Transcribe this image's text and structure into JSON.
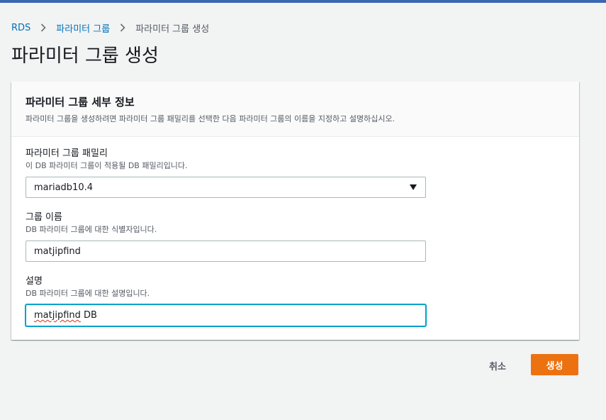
{
  "breadcrumb": {
    "items": [
      "RDS",
      "파라미터 그룹",
      "파라미터 그룹 생성"
    ]
  },
  "page": {
    "title": "파라미터 그룹 생성"
  },
  "panel": {
    "title": "파라미터 그룹 세부 정보",
    "description": "파라미터 그룹을 생성하려면 파라미터 그룹 패밀리를 선택한 다음 파라미터 그룹의 이름을 지정하고 설명하십시오."
  },
  "fields": {
    "family": {
      "label": "파라미터 그룹 패밀리",
      "description": "이 DB 파라미터 그룹이 적용될 DB 패밀리입니다.",
      "value": "mariadb10.4"
    },
    "name": {
      "label": "그룹 이름",
      "description": "DB 파라미터 그룹에 대한 식별자입니다.",
      "value": "matjipfind"
    },
    "desc": {
      "label": "설명",
      "description": "DB 파라미터 그룹에 대한 설명입니다.",
      "value_word": "matjipfind",
      "value_rest": " DB"
    }
  },
  "actions": {
    "cancel": "취소",
    "create": "생성"
  },
  "colors": {
    "link": "#0073bb",
    "primary_button": "#ec7211",
    "focus": "#00a1c9",
    "topbar": "#3a68b2"
  },
  "icons": {
    "breadcrumb_separator": "chevron-right-icon",
    "select_caret": "caret-down-icon"
  }
}
